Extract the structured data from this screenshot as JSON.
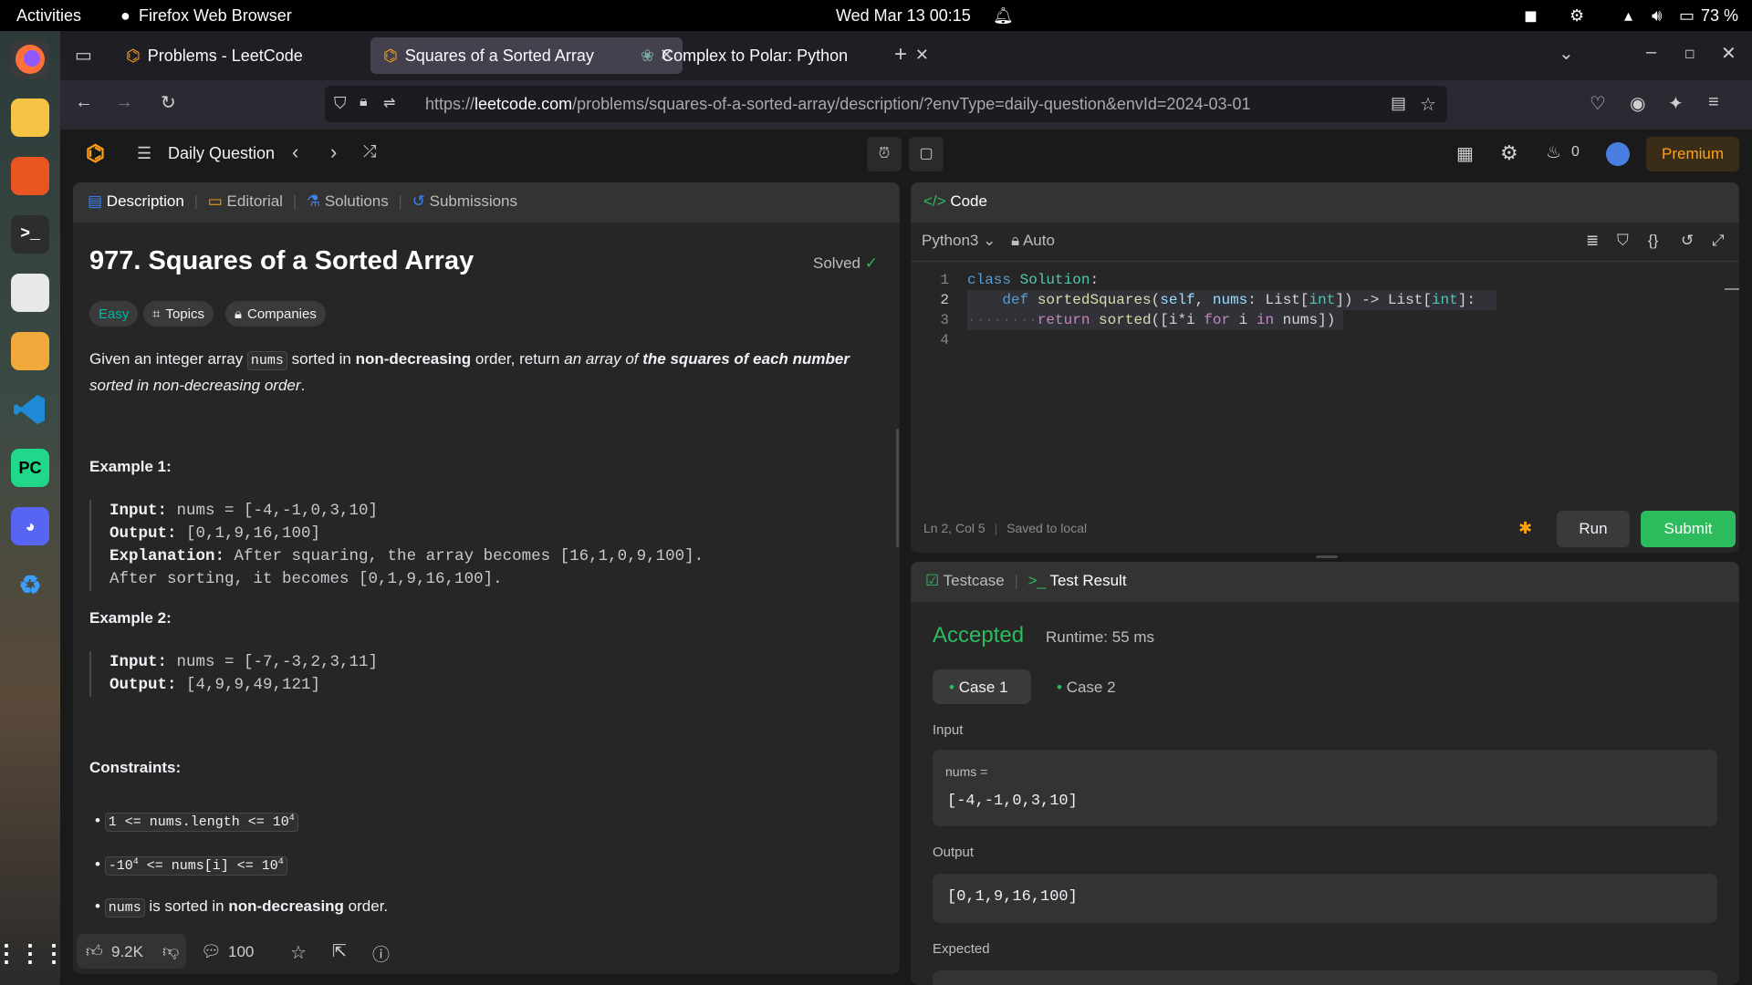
{
  "system": {
    "activities": "Activities",
    "app_name": "Firefox Web Browser",
    "datetime": "Wed Mar 13  00:15",
    "battery": "73 %"
  },
  "browser": {
    "tabs": [
      {
        "title": "Problems - LeetCode"
      },
      {
        "title": "Squares of a Sorted Array"
      },
      {
        "title": "Complex to Polar: Python"
      }
    ],
    "url_prefix": "https://",
    "url_domain": "leetcode.com",
    "url_path": "/problems/squares-of-a-sorted-array/description/?envType=daily-question&envId=2024-03-01"
  },
  "header": {
    "daily_question": "Daily Question",
    "streak_count": "0",
    "premium": "Premium"
  },
  "left_panel": {
    "tabs": [
      "Description",
      "Editorial",
      "Solutions",
      "Submissions"
    ],
    "title": "977. Squares of a Sorted Array",
    "solved": "Solved",
    "difficulty": "Easy",
    "topics": "Topics",
    "companies": "Companies",
    "desc": {
      "p1": "Given an integer array ",
      "code": "nums",
      "p2": " sorted in ",
      "b1": "non-decreasing",
      "p3": " order, return ",
      "i1": "an array of ",
      "bi": "the squares of each number",
      "i2": "sorted in non-decreasing order",
      "end": "."
    },
    "example1_title": "Example 1:",
    "example1": {
      "input_label": "Input:",
      "input": " nums = [-4,-1,0,3,10]",
      "output_label": "Output:",
      "output": " [0,1,9,16,100]",
      "expl_label": "Explanation:",
      "expl": " After squaring, the array becomes [16,1,0,9,100].",
      "expl2": "After sorting, it becomes [0,1,9,16,100]."
    },
    "example2_title": "Example 2:",
    "example2": {
      "input_label": "Input:",
      "input": " nums = [-7,-3,2,3,11]",
      "output_label": "Output:",
      "output": " [4,9,9,49,121]"
    },
    "constraints_title": "Constraints:",
    "constraints": {
      "c1": "1 <= nums.length <= 10",
      "c1_sup": "4",
      "c2": "-10",
      "c2_sup1": "4",
      "c2_mid": " <= nums[i] <= 10",
      "c2_sup2": "4",
      "c3_code": "nums",
      "c3_p1": " is sorted in ",
      "c3_b": "non-decreasing",
      "c3_p2": " order."
    },
    "footer": {
      "likes": "9.2K",
      "comments": "100"
    }
  },
  "code_panel": {
    "title": "Code",
    "language": "Python3",
    "mode": "Auto",
    "lines": [
      "1",
      "2",
      "3",
      "4"
    ],
    "status_pos": "Ln 2, Col 5",
    "status_saved": "Saved to local",
    "run": "Run",
    "submit": "Submit"
  },
  "result_panel": {
    "tab_testcase": "Testcase",
    "tab_result": "Test Result",
    "verdict": "Accepted",
    "runtime": "Runtime: 55 ms",
    "case1": "Case 1",
    "case2": "Case 2",
    "input_label": "Input",
    "var_name": "nums =",
    "input_value": "[-4,-1,0,3,10]",
    "output_label": "Output",
    "output_value": "[0,1,9,16,100]",
    "expected_label": "Expected"
  },
  "colors": {
    "accent_green": "#2cbb5d",
    "easy_teal": "#00b8a3",
    "premium_orange": "#ffa116"
  }
}
